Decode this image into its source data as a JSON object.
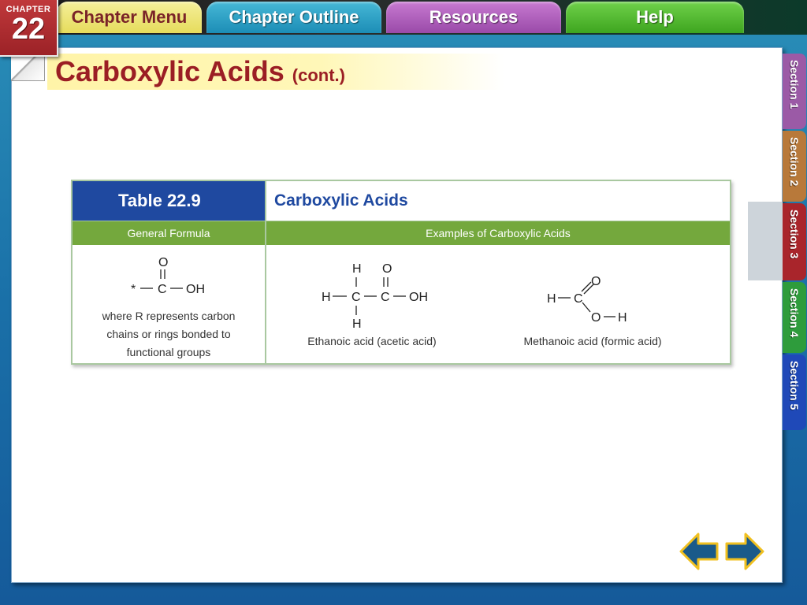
{
  "chapter": {
    "label": "CHAPTER",
    "number": "22"
  },
  "nav_tabs": {
    "chapter_menu": "Chapter Menu",
    "chapter_outline": "Chapter Outline",
    "resources": "Resources",
    "help": "Help"
  },
  "slide": {
    "title": "Carboxylic Acids",
    "title_suffix": "(cont.)"
  },
  "section_tabs": [
    "Section 1",
    "Section 2",
    "Section 3",
    "Section 4",
    "Section 5"
  ],
  "active_section": "Section 3",
  "table": {
    "number": "Table 22.9",
    "name": "Carboxylic Acids",
    "col_general": "General Formula",
    "col_examples": "Examples of Carboxylic Acids",
    "general_formula_caption": [
      "where R represents carbon",
      "chains or rings bonded to",
      "functional groups"
    ],
    "examples": [
      {
        "caption": "Ethanoic acid (acetic acid)"
      },
      {
        "caption": "Methanoic acid (formic acid)"
      }
    ]
  },
  "colors": {
    "chapter_red": "#a9252b",
    "table_blue": "#1f49a0",
    "table_green": "#74a83d",
    "title_red": "#9b1e24",
    "arrow_blue": "#1a5a8a"
  },
  "icons": {
    "prev": "arrow-left-icon",
    "next": "arrow-right-icon"
  }
}
